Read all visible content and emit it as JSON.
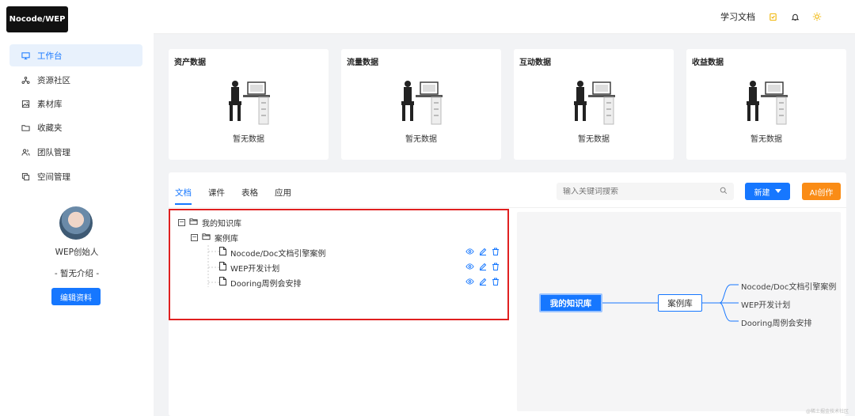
{
  "app": {
    "logo": "Nocode/WEP"
  },
  "topbar": {
    "docs": "学习文档"
  },
  "sidebar": {
    "items": [
      {
        "label": "工作台",
        "icon": "monitor-icon",
        "active": true
      },
      {
        "label": "资源社区",
        "icon": "share-icon"
      },
      {
        "label": "素材库",
        "icon": "image-icon"
      },
      {
        "label": "收藏夹",
        "icon": "folder-icon"
      },
      {
        "label": "团队管理",
        "icon": "team-icon"
      },
      {
        "label": "空间管理",
        "icon": "copy-icon"
      }
    ]
  },
  "profile": {
    "name": "WEP创始人",
    "intro": "- 暂无介绍 -",
    "edit_label": "编辑资料"
  },
  "stats": [
    {
      "title": "资产数据",
      "empty": "暂无数据"
    },
    {
      "title": "流量数据",
      "empty": "暂无数据"
    },
    {
      "title": "互动数据",
      "empty": "暂无数据"
    },
    {
      "title": "收益数据",
      "empty": "暂无数据"
    }
  ],
  "panel": {
    "tabs": [
      "文档",
      "课件",
      "表格",
      "应用"
    ],
    "active_tab": 0,
    "search_placeholder": "输入关键词搜索",
    "new_label": "新建",
    "ai_label": "AI创作"
  },
  "tree": {
    "root": "我的知识库",
    "folder": "案例库",
    "files": [
      "Nocode/Doc文档引擎案例",
      "WEP开发计划",
      "Dooring周例会安排"
    ]
  },
  "mindmap": {
    "root": "我的知识库",
    "mid": "案例库",
    "leaves": [
      "Nocode/Doc文档引擎案例",
      "WEP开发计划",
      "Dooring周例会安排"
    ]
  },
  "colors": {
    "accent": "#1677ff",
    "ai": "#fa8c16",
    "highlight": "#e02020"
  },
  "watermark": "@稀土掘金技术社区"
}
